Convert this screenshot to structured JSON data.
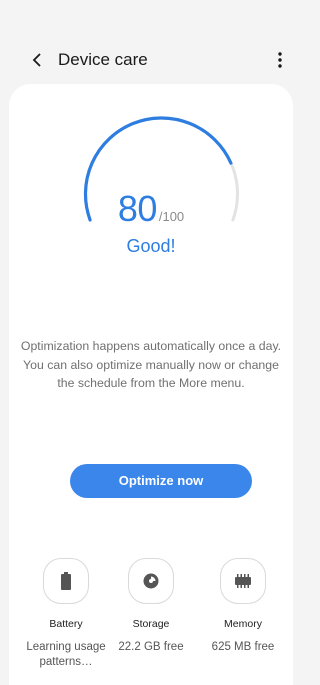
{
  "header": {
    "title": "Device care",
    "back_icon": "chevron-left-icon",
    "more_icon": "more-vertical-icon"
  },
  "score": {
    "value": "80",
    "max": "/100",
    "status": "Good!",
    "fraction": 0.8
  },
  "description": "Optimization happens automatically once a day. You can also optimize manually now or change the schedule from the More menu.",
  "optimize_button": "Optimize now",
  "tools": [
    {
      "label": "Battery",
      "value": "Learning usage patterns…",
      "icon": "battery-icon"
    },
    {
      "label": "Storage",
      "value": "22.2 GB free",
      "icon": "storage-pie-icon"
    },
    {
      "label": "Memory",
      "value": "625 MB free",
      "icon": "memory-chip-icon"
    }
  ],
  "colors": {
    "accent": "#2e7de1",
    "button": "#3a86ea",
    "gauge_track": "#e3e3e3",
    "background": "#f4f4f4"
  }
}
